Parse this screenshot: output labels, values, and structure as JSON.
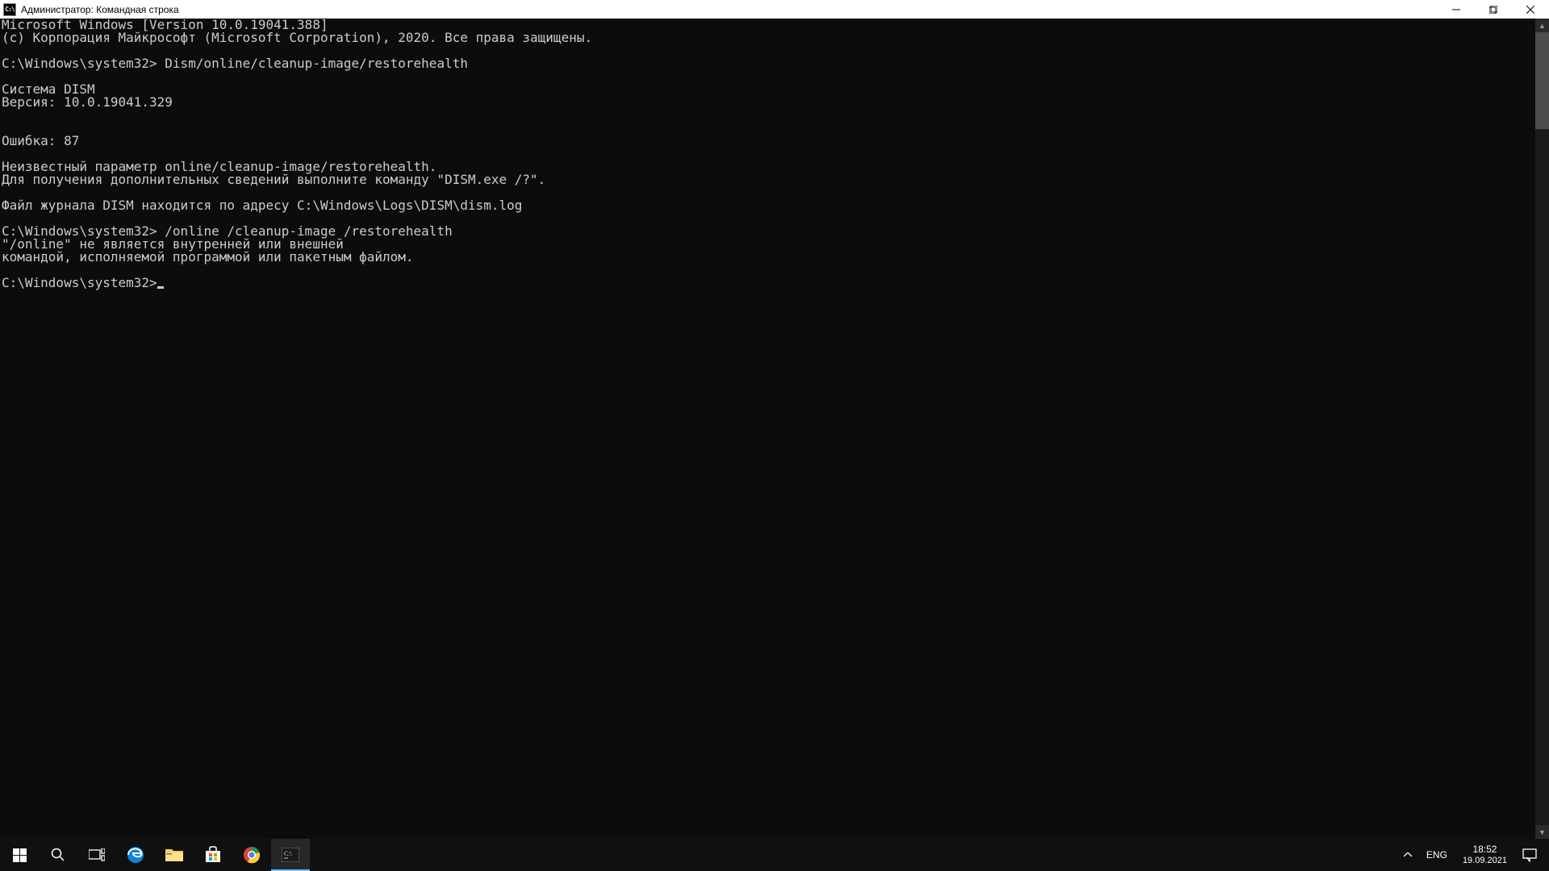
{
  "window": {
    "title": "Администратор: Командная строка",
    "icon_label": "C:\\"
  },
  "console": {
    "lines": [
      "Microsoft Windows [Version 10.0.19041.388]",
      "(c) Корпорация Майкрософт (Microsoft Corporation), 2020. Все права защищены.",
      "",
      "C:\\Windows\\system32> Dism/online/cleanup-image/restorehealth",
      "",
      "Cистема DISM",
      "Версия: 10.0.19041.329",
      "",
      "",
      "Ошибка: 87",
      "",
      "Неизвестный параметр online/cleanup-image/restorehealth.",
      "Для получения дополнительных сведений выполните команду \"DISM.exe /?\".",
      "",
      "Файл журнала DISM находится по адресу C:\\Windows\\Logs\\DISM\\dism.log",
      "",
      "C:\\Windows\\system32> /online /cleanup-image /restorehealth",
      "\"/online\" не является внутренней или внешней",
      "командой, исполняемой программой или пакетным файлом.",
      ""
    ],
    "prompt": "C:\\Windows\\system32>"
  },
  "taskbar": {
    "language": "ENG",
    "time": "18:52",
    "date": "19.09.2021"
  }
}
